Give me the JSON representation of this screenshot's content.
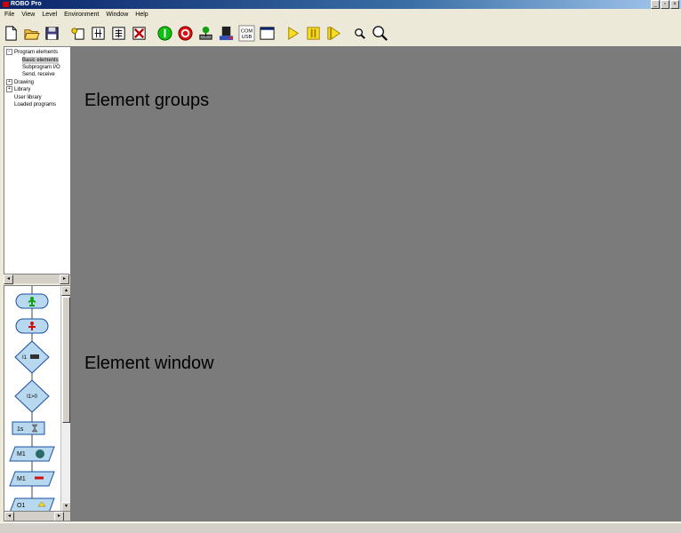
{
  "window": {
    "title": "ROBO Pro",
    "buttons": [
      "_",
      "▫",
      "×"
    ]
  },
  "menu": [
    "File",
    "View",
    "Level",
    "Environment",
    "Window",
    "Help"
  ],
  "toolbar": [
    {
      "name": "new-icon"
    },
    {
      "name": "open-icon"
    },
    {
      "name": "save-icon"
    },
    {
      "name": "new-subprogram-icon"
    },
    {
      "name": "copy-subprogram-icon"
    },
    {
      "name": "edit-subprogram-icon"
    },
    {
      "name": "delete-subprogram-icon"
    },
    {
      "name": "start-icon"
    },
    {
      "name": "stop-icon"
    },
    {
      "name": "download-icon"
    },
    {
      "name": "interface-icon"
    },
    {
      "name": "com-usb-icon",
      "text": "COM\nUSB"
    },
    {
      "name": "test-window-icon"
    },
    {
      "name": "debug-play-icon"
    },
    {
      "name": "debug-pause-icon"
    },
    {
      "name": "debug-step-icon"
    },
    {
      "name": "zoom-out-icon"
    },
    {
      "name": "zoom-in-icon"
    }
  ],
  "tree": {
    "items": [
      {
        "label": "Program elements",
        "expander": "−",
        "indent": 0
      },
      {
        "label": "Basic elements",
        "indent": 1,
        "selected": true
      },
      {
        "label": "Subprogram I/O",
        "indent": 1
      },
      {
        "label": "Send, receive",
        "indent": 1
      },
      {
        "label": "Drawing",
        "expander": "+",
        "indent": 0
      },
      {
        "label": "Library",
        "expander": "+",
        "indent": 0
      },
      {
        "label": "User library",
        "indent": 0
      },
      {
        "label": "Loaded programs",
        "indent": 0
      }
    ]
  },
  "elements": {
    "branch_label": "I1",
    "compare_label": "I1>0",
    "wait_label": "1s",
    "motor_label": "M1",
    "motor2_label": "M1",
    "output_label": "O1"
  },
  "canvas": {
    "label_groups": "Element groups",
    "label_window": "Element window"
  }
}
